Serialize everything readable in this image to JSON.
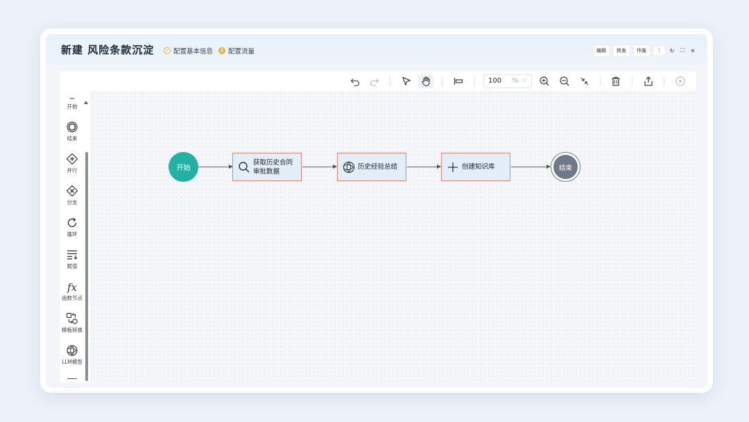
{
  "window": {
    "title": "新建 风险条款沉淀",
    "steps": [
      {
        "label": "配置基本信息",
        "state": "done",
        "marker": "✓"
      },
      {
        "label": "配置流量",
        "state": "current",
        "marker": "2"
      }
    ],
    "actions": [
      "编辑",
      "转发",
      "作废"
    ],
    "controls": {
      "more": "⋮",
      "refresh": "↻",
      "maximize": "⛶",
      "close": "✕"
    }
  },
  "toolbar": {
    "zoom_value": "100",
    "zoom_unit": "%",
    "tools": [
      "undo-icon",
      "redo-icon",
      "select-icon",
      "hand-icon",
      "align-icon",
      "zoom-in-icon",
      "zoom-out-icon",
      "fit-icon",
      "delete-icon",
      "export-icon",
      "run-icon"
    ]
  },
  "sidebar": {
    "items": [
      {
        "label": "开始",
        "icon": "start-icon"
      },
      {
        "label": "结束",
        "icon": "end-icon"
      },
      {
        "label": "并行",
        "icon": "parallel-icon"
      },
      {
        "label": "分支",
        "icon": "branch-icon"
      },
      {
        "label": "循环",
        "icon": "loop-icon"
      },
      {
        "label": "赋值",
        "icon": "assign-icon"
      },
      {
        "label": "函数节点",
        "icon": "function-icon"
      },
      {
        "label": "模板转换",
        "icon": "template-icon"
      },
      {
        "label": "LLM模型",
        "icon": "llm-icon"
      }
    ]
  },
  "flow": {
    "start": "开始",
    "end": "结束",
    "tasks": [
      {
        "line1": "获取历史合同",
        "line2": "审批数据",
        "icon": "search-icon"
      },
      {
        "line1": "历史经验总结",
        "line2": "",
        "icon": "llm-icon"
      },
      {
        "line1": "创建知识库",
        "line2": "",
        "icon": "plus-icon"
      }
    ]
  },
  "colors": {
    "start_node": "#23b0a5",
    "end_node": "#6f7888",
    "task_fill": "#e2eefa",
    "task_border": "#e4826f",
    "step_done": "#e7b53a",
    "step_current": "#f0ad2d"
  }
}
